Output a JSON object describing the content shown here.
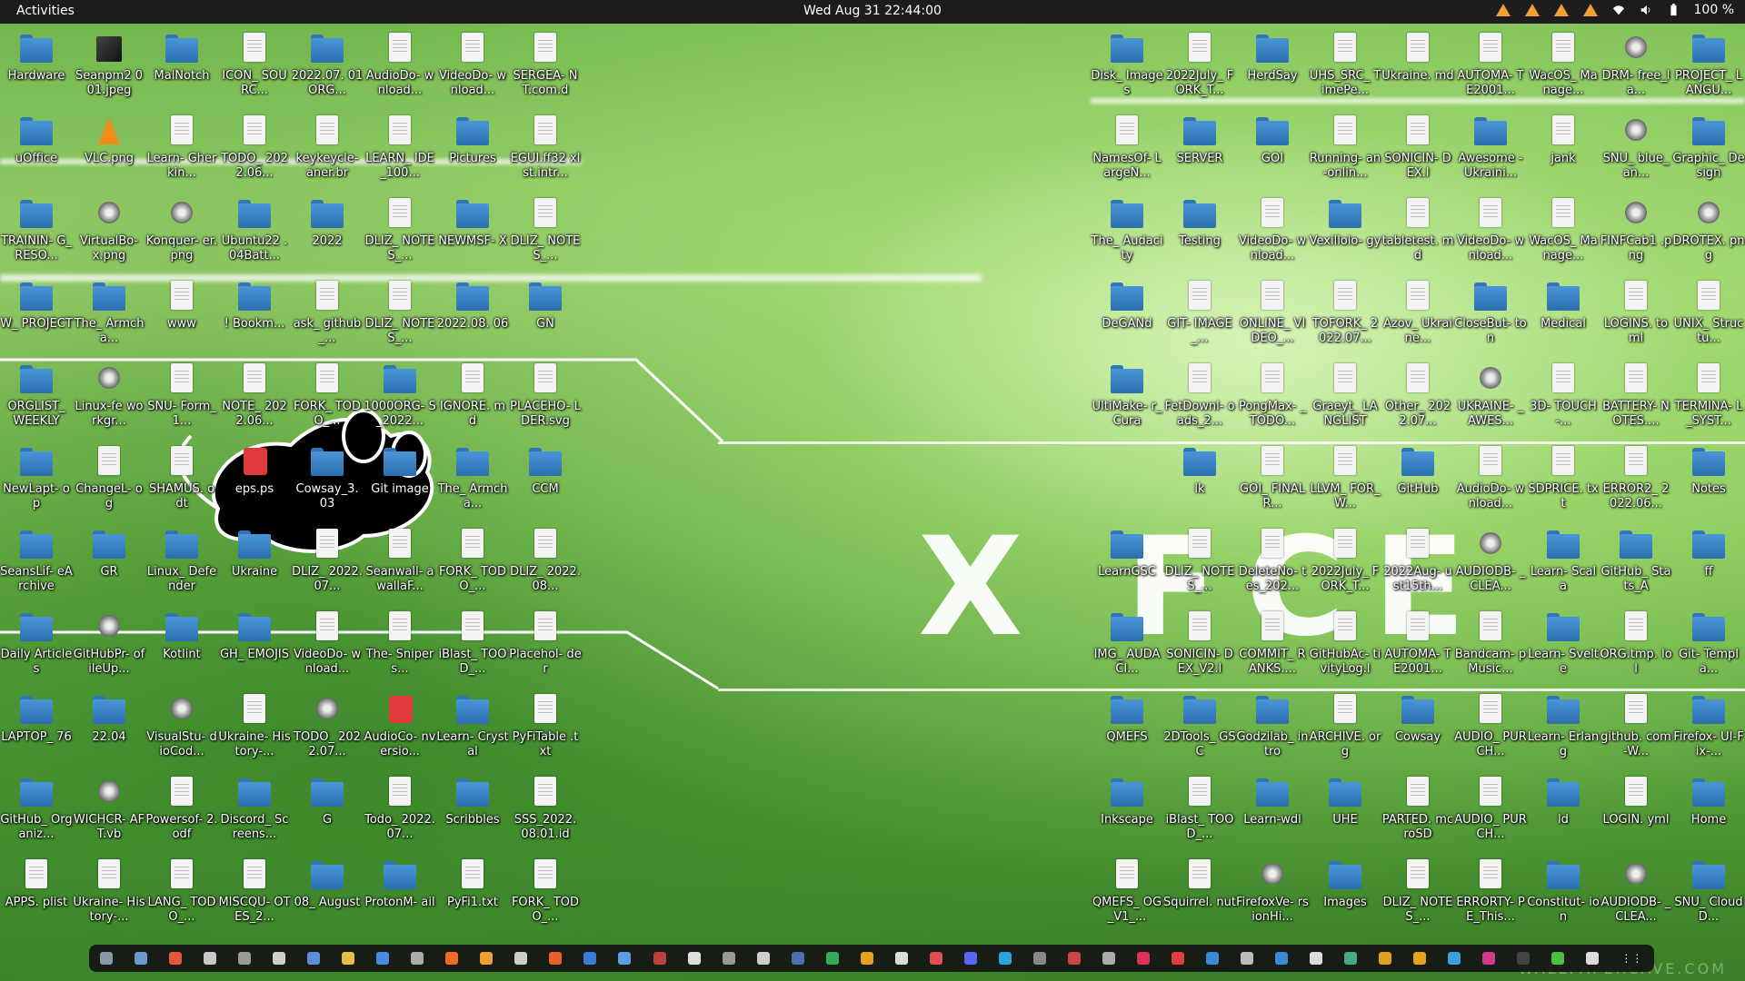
{
  "topbar": {
    "activities": "Activities",
    "clock": "Wed Aug 31  22:44:00",
    "battery": "100 %"
  },
  "wallpaper": {
    "text": "X FCE",
    "watermark": "WALLPAPERCAVE.COM"
  },
  "left_icons": [
    [
      "Hardware",
      "Seanpm2 001.jpeg",
      "MalNotch",
      "ICON_ SOURC...",
      "2022.07. 01ORG...",
      "AudioDo- wnload...",
      "VideoDo- wnload...",
      "SERGEA- NT.com.d"
    ],
    [
      "uOffice",
      "VLC.png",
      "Learn- Gherkin...",
      "TODO_ 2022.06...",
      "keykeycle- aner.br",
      "LEARN_ IDE_100...",
      "Pictures",
      "EGUI.ff32 xlst.intr..."
    ],
    [
      "TRAININ- G_RESO...",
      "VirtualBo- x.png",
      "Konquer- er.png",
      "Ubuntu22 .04Batt...",
      "2022",
      "DLIZ_ NOTES_...",
      "NEWMSF- X",
      "DLIZ_ NOTES_..."
    ],
    [
      "W_ PROJECT",
      "The_ Armcha...",
      "www",
      "! Bookm...",
      "ask_ github_...",
      "DLIZ_ NOTES_...",
      "2022.08. 06",
      "GN"
    ],
    [
      "ORGLIST_ WEEKLY",
      "Linux-fe workgr...",
      "SNU- Form_1...",
      "NOTE_ 2022.06...",
      "FORK_ TODO_...",
      "1000ORG- S_2022...",
      "IGNORE. md",
      "PLACEHO- LDER.svg"
    ],
    [
      "NewLapt- op",
      "ChangeL- og",
      "SHAMUS. odt",
      "eps.ps",
      "Cowsay_3. 03",
      "Git image",
      "The_ Armcha...",
      "CCM"
    ],
    [
      "SeansLif- eArchive",
      "GR",
      "Linux_ Defender",
      "Ukraine",
      "DLIZ_ 2022.07...",
      "Seanwall- awallaF...",
      "FORK_ TODO_...",
      "DLIZ_ 2022.08..."
    ],
    [
      "Daily Articles",
      "GitHubPr- ofileUp...",
      "Kotlint",
      "GH_ EMOJIS",
      "VideoDo- wnload...",
      "The- Snipers...",
      "iBlast_ TOOD_...",
      "Placehol- der"
    ],
    [
      "LAPTOP_ 76",
      "22.04",
      "VisualStu- dioCod...",
      "Ukraine- History-...",
      "TODO_ 2022.07...",
      "AudioCo- nversio...",
      "Learn- Crystal",
      "PyFiTable .txt"
    ],
    [
      "GitHub_ Organiz...",
      "WICHCR- AFT.vb",
      "Powersof- 2.odf",
      "Discord_ Screens...",
      "G",
      "Todo_ 2022.07...",
      "Scribbles",
      "SSS_2022. 08.01.id"
    ],
    [
      "APPS. plist",
      "Ukraine- History-...",
      "LANG_ TODO_...",
      "MISCQU- OTES_2...",
      "08_ August",
      "ProtonM- ail",
      "PyFi1.txt",
      "FORK_ TODO_..."
    ]
  ],
  "right_icons": [
    [
      "Disk_ Images",
      "2022July_ FORK_T...",
      "HerdSay",
      "UHS_SRC_ TimePe...",
      "Ukraine. md",
      "AUTOMA- TE2001...",
      "WacOS_ Manage...",
      "DRM- free_la...",
      "PROJECT_ LANGU..."
    ],
    [
      "NamesOf- LargeN...",
      "SERVER",
      "GOI",
      "Running- an-onlin...",
      "SONICIN- DEX.l",
      "Awesome -Ukraini...",
      "jank",
      "SNU_ blue_an...",
      "Graphic_ Design"
    ],
    [
      "The_ Audacity",
      "Testing",
      "VideoDo- wnload...",
      "Vexillolo- gy",
      "tabletest. md",
      "VideoDo- wnload...",
      "WacOS_ Manage...",
      "FINFCab1 .png",
      "DROTEX. png"
    ],
    [
      "DeGANd",
      "GIT- IMAGE_...",
      "ONLINE_ VIDEO_...",
      "TOFORK_ 2022.07...",
      "Azov_ Ukraine...",
      "CloseBut- ton",
      "Medical",
      "LOGINS. toml",
      "UNIX_ Structu..."
    ],
    [
      "UltiMake- r_Cura",
      "FetDownl- oads_2...",
      "PongMax- _TODO...",
      "Graeyt_ LANGLIST",
      "Other_ 2022.07...",
      "UKRAINE- _AWES...",
      "3D- TOUCH-...",
      "BATTERY- NOTES....",
      "TERMINA- L_SYST..."
    ],
    [
      "",
      "lk",
      "GOI_ FINALR...",
      "LLVM_ FOR_W...",
      "GitHub",
      "AudioDo- wnload...",
      "SDPRICE. txt",
      "ERROR2_ 2022.06...",
      "Notes"
    ],
    [
      "LearnGSC",
      "DLIZ_ NOTES_...",
      "DeleteNo- tes_202...",
      "2022July_ FORK_T...",
      "2022Aug- ust15th...",
      "AUDIODB- _CLEA...",
      "Learn- Scala",
      "GitHub_ Stats_A",
      "ff"
    ],
    [
      "IMG_ AUDACI...",
      "SONICIN- DEX_V2.l",
      "COMMIT_ RANKS....",
      "GitHubAc- tivityLog.l",
      "AUTOMA- TE2001...",
      "Bandcam- pMusic...",
      "Learn- Svelte",
      "ORG.tmp. lol",
      "Git- Templa..."
    ],
    [
      "QMEFS",
      "2DTools_ GSC",
      "Godzilab_ intro",
      "ARCHIVE. org",
      "Cowsay",
      "AUDIO_ PURCH...",
      "Learn- Erlang",
      "github. com-W...",
      "Firefox- UI-Fix-..."
    ],
    [
      "Inkscape",
      "iBlast_ TOOD_...",
      "Learn-wdl",
      "UHE",
      "PARTED. mcroSD",
      "AUDIO_ PURCH...",
      "ld",
      "LOGIN. yml",
      "Home"
    ],
    [
      "QMEFS_ OG_V1_...",
      "Squirrel. nut",
      "FirefoxVe- rsionHi...",
      "Images",
      "DLIZ_ NOTES_...",
      "ERRORTY- PE_This...",
      "Constitut- ion",
      "AUDIODB- _CLEA...",
      "SNU_ CloudD..."
    ]
  ],
  "left_types": [
    [
      "folder",
      "img",
      "folder",
      "file",
      "folder",
      "file",
      "file",
      "file"
    ],
    [
      "folder",
      "vlc",
      "file",
      "file",
      "file",
      "file",
      "folder",
      "file"
    ],
    [
      "folder",
      "app",
      "app",
      "folder",
      "folder",
      "file",
      "folder",
      "file"
    ],
    [
      "folder",
      "folder",
      "file",
      "folder",
      "file",
      "file",
      "folder",
      "folder"
    ],
    [
      "folder",
      "app",
      "file",
      "file",
      "file",
      "folder",
      "file",
      "file"
    ],
    [
      "folder",
      "file",
      "file",
      "red",
      "folder",
      "folder",
      "folder",
      "folder"
    ],
    [
      "folder",
      "folder",
      "folder",
      "folder",
      "file",
      "file",
      "file",
      "file"
    ],
    [
      "folder",
      "app",
      "folder",
      "folder",
      "file",
      "file",
      "file",
      "file"
    ],
    [
      "folder",
      "folder",
      "app",
      "file",
      "app",
      "red",
      "folder",
      "file"
    ],
    [
      "folder",
      "app",
      "file",
      "folder",
      "folder",
      "file",
      "folder",
      "file"
    ],
    [
      "file",
      "file",
      "file",
      "file",
      "folder",
      "folder",
      "file",
      "file"
    ]
  ],
  "right_types": [
    [
      "folder",
      "file",
      "folder",
      "file",
      "file",
      "file",
      "file",
      "app",
      "folder"
    ],
    [
      "file",
      "folder",
      "folder",
      "file",
      "file",
      "folder",
      "file",
      "app",
      "folder"
    ],
    [
      "folder",
      "folder",
      "file",
      "folder",
      "file",
      "file",
      "file",
      "app",
      "app"
    ],
    [
      "folder",
      "file",
      "file",
      "file",
      "file",
      "folder",
      "folder",
      "file",
      "file"
    ],
    [
      "folder",
      "file",
      "file",
      "file",
      "file",
      "app",
      "file",
      "file",
      "file"
    ],
    [
      "none",
      "folder",
      "file",
      "file",
      "folder",
      "file",
      "file",
      "file",
      "folder"
    ],
    [
      "folder",
      "file",
      "file",
      "file",
      "file",
      "app",
      "folder",
      "folder",
      "folder"
    ],
    [
      "folder",
      "file",
      "file",
      "file",
      "file",
      "file",
      "folder",
      "file",
      "folder"
    ],
    [
      "folder",
      "folder",
      "folder",
      "file",
      "folder",
      "file",
      "folder",
      "file",
      "folder"
    ],
    [
      "folder",
      "file",
      "folder",
      "folder",
      "file",
      "file",
      "folder",
      "file",
      "folder"
    ],
    [
      "file",
      "file",
      "app",
      "folder",
      "file",
      "file",
      "folder",
      "app",
      "folder"
    ]
  ],
  "dock_colors": [
    "#8899aa",
    "#6a9ad0",
    "#e6563c",
    "#c8c8c8",
    "#9a9a9a",
    "#cfcfcf",
    "#5a8fd8",
    "#e2c04a",
    "#4a8ae0",
    "#aaaaaa",
    "#f06a28",
    "#f0a030",
    "#cccccc",
    "#e8602c",
    "#3a7bd5",
    "#5aa0e0",
    "#c04040",
    "#dddddd",
    "#999999",
    "#cccccc",
    "#4b6fb0",
    "#33aa55",
    "#e8a020",
    "#dddddd",
    "#e05050",
    "#5865f2",
    "#2aa3e0",
    "#888888",
    "#cc4444",
    "#aaaaaa",
    "#dd3355",
    "#e04040",
    "#3a8ad8",
    "#bbbbbb",
    "#3a8ad8",
    "#dddddd",
    "#44aa88",
    "#e2a020",
    "#e8a020",
    "#3aa0e0",
    "#d03a8a",
    "#444444",
    "#4ac040",
    "#dddddd"
  ]
}
